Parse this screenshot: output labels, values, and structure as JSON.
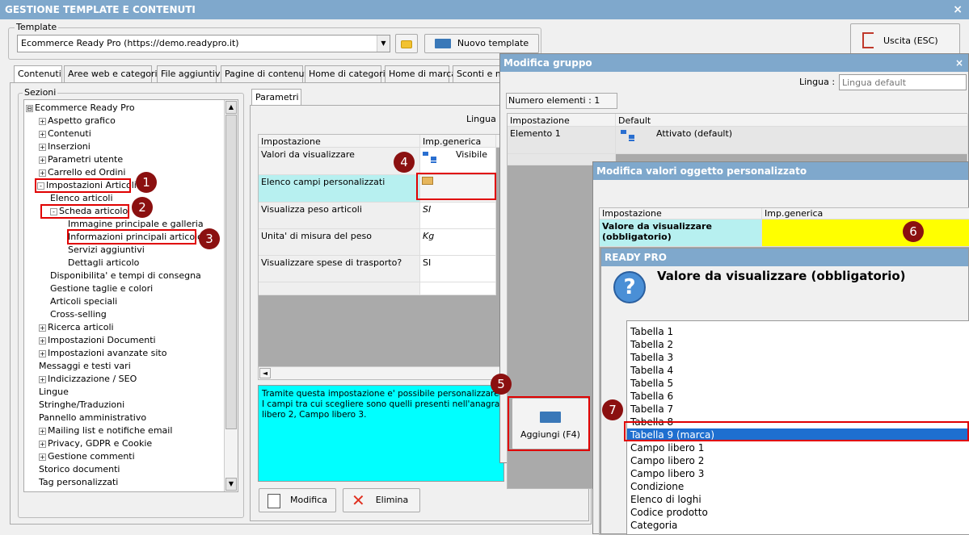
{
  "window": {
    "title": "GESTIONE TEMPLATE E CONTENUTI",
    "close": "×"
  },
  "template": {
    "group_label": "Template",
    "selected": "Ecommerce Ready Pro (https://demo.readypro.it)",
    "new_button": "Nuovo template"
  },
  "exit_button": "Uscita (ESC)",
  "tabs": [
    "Contenuti",
    "Aree web e categorie",
    "File aggiuntivi",
    "Pagine di contenuti",
    "Home di categoria",
    "Home di marca",
    "Sconti e ma"
  ],
  "sections": {
    "label": "Sezioni",
    "tree": [
      {
        "text": "Ecommerce Ready Pro",
        "pm": "⊟"
      },
      {
        "text": "Aspetto grafico",
        "pm": "+"
      },
      {
        "text": "Contenuti",
        "pm": "+"
      },
      {
        "text": "Inserzioni",
        "pm": "+"
      },
      {
        "text": "Parametri utente",
        "pm": "+"
      },
      {
        "text": "Carrello ed Ordini",
        "pm": "+"
      },
      {
        "text": "Impostazioni Articoli",
        "pm": "-"
      },
      {
        "text": "Elenco articoli",
        "pm": ""
      },
      {
        "text": "Scheda articolo",
        "pm": "-"
      },
      {
        "text": "Immagine principale e galleria",
        "pm": ""
      },
      {
        "text": "Informazioni principali articolo",
        "pm": ""
      },
      {
        "text": "Servizi aggiuntivi",
        "pm": ""
      },
      {
        "text": "Dettagli articolo",
        "pm": ""
      },
      {
        "text": "Disponibilita' e tempi di consegna",
        "pm": ""
      },
      {
        "text": "Gestione taglie e colori",
        "pm": ""
      },
      {
        "text": "Articoli speciali",
        "pm": ""
      },
      {
        "text": "Cross-selling",
        "pm": ""
      },
      {
        "text": "Ricerca articoli",
        "pm": "+"
      },
      {
        "text": "Impostazioni Documenti",
        "pm": "+"
      },
      {
        "text": "Impostazioni avanzate sito",
        "pm": "+"
      },
      {
        "text": "Messaggi e testi vari",
        "pm": ""
      },
      {
        "text": "Indicizzazione / SEO",
        "pm": "+"
      },
      {
        "text": "Lingue",
        "pm": ""
      },
      {
        "text": "Stringhe/Traduzioni",
        "pm": ""
      },
      {
        "text": "Pannello amministrativo",
        "pm": ""
      },
      {
        "text": "Mailing list e notifiche email",
        "pm": "+"
      },
      {
        "text": "Privacy, GDPR e Cookie",
        "pm": "+"
      },
      {
        "text": "Gestione commenti",
        "pm": "+"
      },
      {
        "text": "Storico documenti",
        "pm": ""
      },
      {
        "text": "Tag personalizzati",
        "pm": ""
      }
    ]
  },
  "params": {
    "tab": "Parametri",
    "lingua_label": "Lingua :",
    "col_setting": "Impostazione",
    "col_value": "Imp.generica",
    "rows": [
      {
        "name": "Valori da visualizzare",
        "value": "Visibile"
      },
      {
        "name": "Elenco campi personalizzati",
        "value": ""
      },
      {
        "name": "Visualizza peso articoli",
        "value": "SI"
      },
      {
        "name": "Unita' di misura del peso",
        "value": "Kg"
      },
      {
        "name": "Visualizzare spese di trasporto?",
        "value": "SI"
      }
    ],
    "description": "Tramite questa impostazione e' possibile personalizzare i cam\nI campi tra cui scegliere sono quelli presenti nell'anagrafica del\nlibero 2, Campo libero 3.",
    "edit_button": "Modifica",
    "delete_button": "Elimina"
  },
  "group_dialog": {
    "title": "Modifica gruppo",
    "close": "×",
    "lingua_label": "Lingua :",
    "lingua_placeholder": "Lingua default",
    "count_label": "Numero elementi : 1",
    "col_setting": "Impostazione",
    "col_default": "Default",
    "element_name": "Elemento 1",
    "element_value": "Attivato (default)",
    "add_button": "Aggiungi (F4)"
  },
  "custom_dialog": {
    "title": "Modifica valori oggetto personalizzato",
    "col_setting": "Impostazione",
    "col_value": "Imp.generica",
    "row_name": "Valore da visualizzare (obbligatorio)"
  },
  "picker": {
    "title": "READY PRO",
    "question": "Valore da visualizzare (obbligatorio)",
    "options": [
      "Tabella 1",
      "Tabella 2",
      "Tabella 3",
      "Tabella 4",
      "Tabella 5",
      "Tabella 6",
      "Tabella 7",
      "Tabella 8",
      "Tabella 9 (marca)",
      "Campo libero 1",
      "Campo libero 2",
      "Campo libero 3",
      "Condizione",
      "Elenco di loghi",
      "Codice prodotto",
      "Categoria"
    ],
    "selected": "Tabella 9 (marca)"
  },
  "badges": [
    "1",
    "2",
    "3",
    "4",
    "5",
    "6",
    "7"
  ],
  "colors": {
    "titlebar": "#7fa8cc",
    "highlight": "#e00000",
    "badge": "#8b1010",
    "yellow": "#ffff00",
    "cyan": "#00ffff",
    "select": "#1e6fd0"
  }
}
